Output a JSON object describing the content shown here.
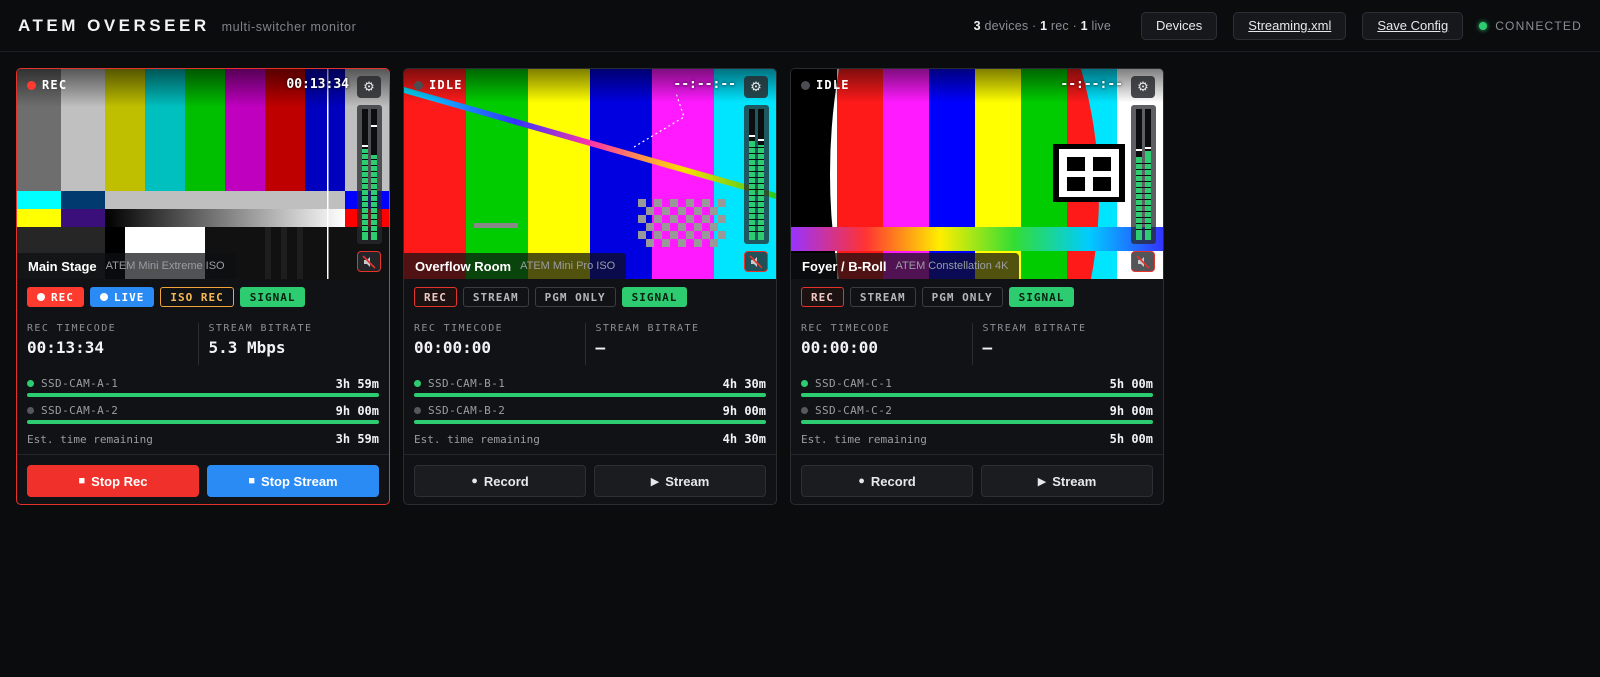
{
  "app": {
    "brand": "ATEM OVERSEER",
    "subtitle": "multi-switcher monitor"
  },
  "topbar": {
    "stats": {
      "devices": "3",
      "devices_label": "devices",
      "rec": "1",
      "rec_label": "rec",
      "live": "1",
      "live_label": "live",
      "sep": "·"
    },
    "devices_button": "Devices",
    "streaming_button": "Streaming.xml",
    "save_button": "Save Config",
    "connection": "CONNECTED"
  },
  "colors": {
    "rec": "#ff3b30",
    "live": "#2b8bf5",
    "iso": "#f0a43a",
    "signal": "#2ecc71",
    "background": "#0b0c0e"
  },
  "cards": [
    {
      "state": "REC",
      "preview_timecode": "00:13:34",
      "name": "Main Stage",
      "model": "ATEM Mini Extreme ISO",
      "badges": {
        "rec": "REC",
        "stream": "LIVE",
        "third": "ISO REC",
        "signal": "SIGNAL"
      },
      "rec_timecode_label": "REC TIMECODE",
      "rec_timecode": "00:13:34",
      "bitrate_label": "STREAM BITRATE",
      "bitrate": "5.3 Mbps",
      "drives": [
        {
          "name": "SSD-CAM-A-1",
          "time": "3h 59m",
          "active": true
        },
        {
          "name": "SSD-CAM-A-2",
          "time": "9h 00m",
          "active": false
        }
      ],
      "est_label": "Est. time remaining",
      "est_value": "3h 59m",
      "primary_action": "Stop Rec",
      "secondary_action": "Stop Stream",
      "gear_icon": "gear-icon",
      "mute_icon": "speaker-muted-icon"
    },
    {
      "state": "IDLE",
      "preview_timecode": "--:--:--",
      "name": "Overflow Room",
      "model": "ATEM Mini Pro ISO",
      "badges": {
        "rec": "REC",
        "stream": "STREAM",
        "third": "PGM ONLY",
        "signal": "SIGNAL"
      },
      "rec_timecode_label": "REC TIMECODE",
      "rec_timecode": "00:00:00",
      "bitrate_label": "STREAM BITRATE",
      "bitrate": "—",
      "drives": [
        {
          "name": "SSD-CAM-B-1",
          "time": "4h 30m",
          "active": true
        },
        {
          "name": "SSD-CAM-B-2",
          "time": "9h 00m",
          "active": false
        }
      ],
      "est_label": "Est. time remaining",
      "est_value": "4h 30m",
      "primary_action": "Record",
      "secondary_action": "Stream",
      "gear_icon": "gear-icon",
      "mute_icon": "speaker-muted-icon"
    },
    {
      "state": "IDLE",
      "preview_timecode": "--:--:--",
      "name": "Foyer / B-Roll",
      "model": "ATEM Constellation 4K",
      "badges": {
        "rec": "REC",
        "stream": "STREAM",
        "third": "PGM ONLY",
        "signal": "SIGNAL"
      },
      "rec_timecode_label": "REC TIMECODE",
      "rec_timecode": "00:00:00",
      "bitrate_label": "STREAM BITRATE",
      "bitrate": "—",
      "drives": [
        {
          "name": "SSD-CAM-C-1",
          "time": "5h 00m",
          "active": true
        },
        {
          "name": "SSD-CAM-C-2",
          "time": "9h 00m",
          "active": false
        }
      ],
      "est_label": "Est. time remaining",
      "est_value": "5h 00m",
      "primary_action": "Record",
      "secondary_action": "Stream",
      "gear_icon": "gear-icon",
      "mute_icon": "speaker-muted-icon"
    }
  ]
}
